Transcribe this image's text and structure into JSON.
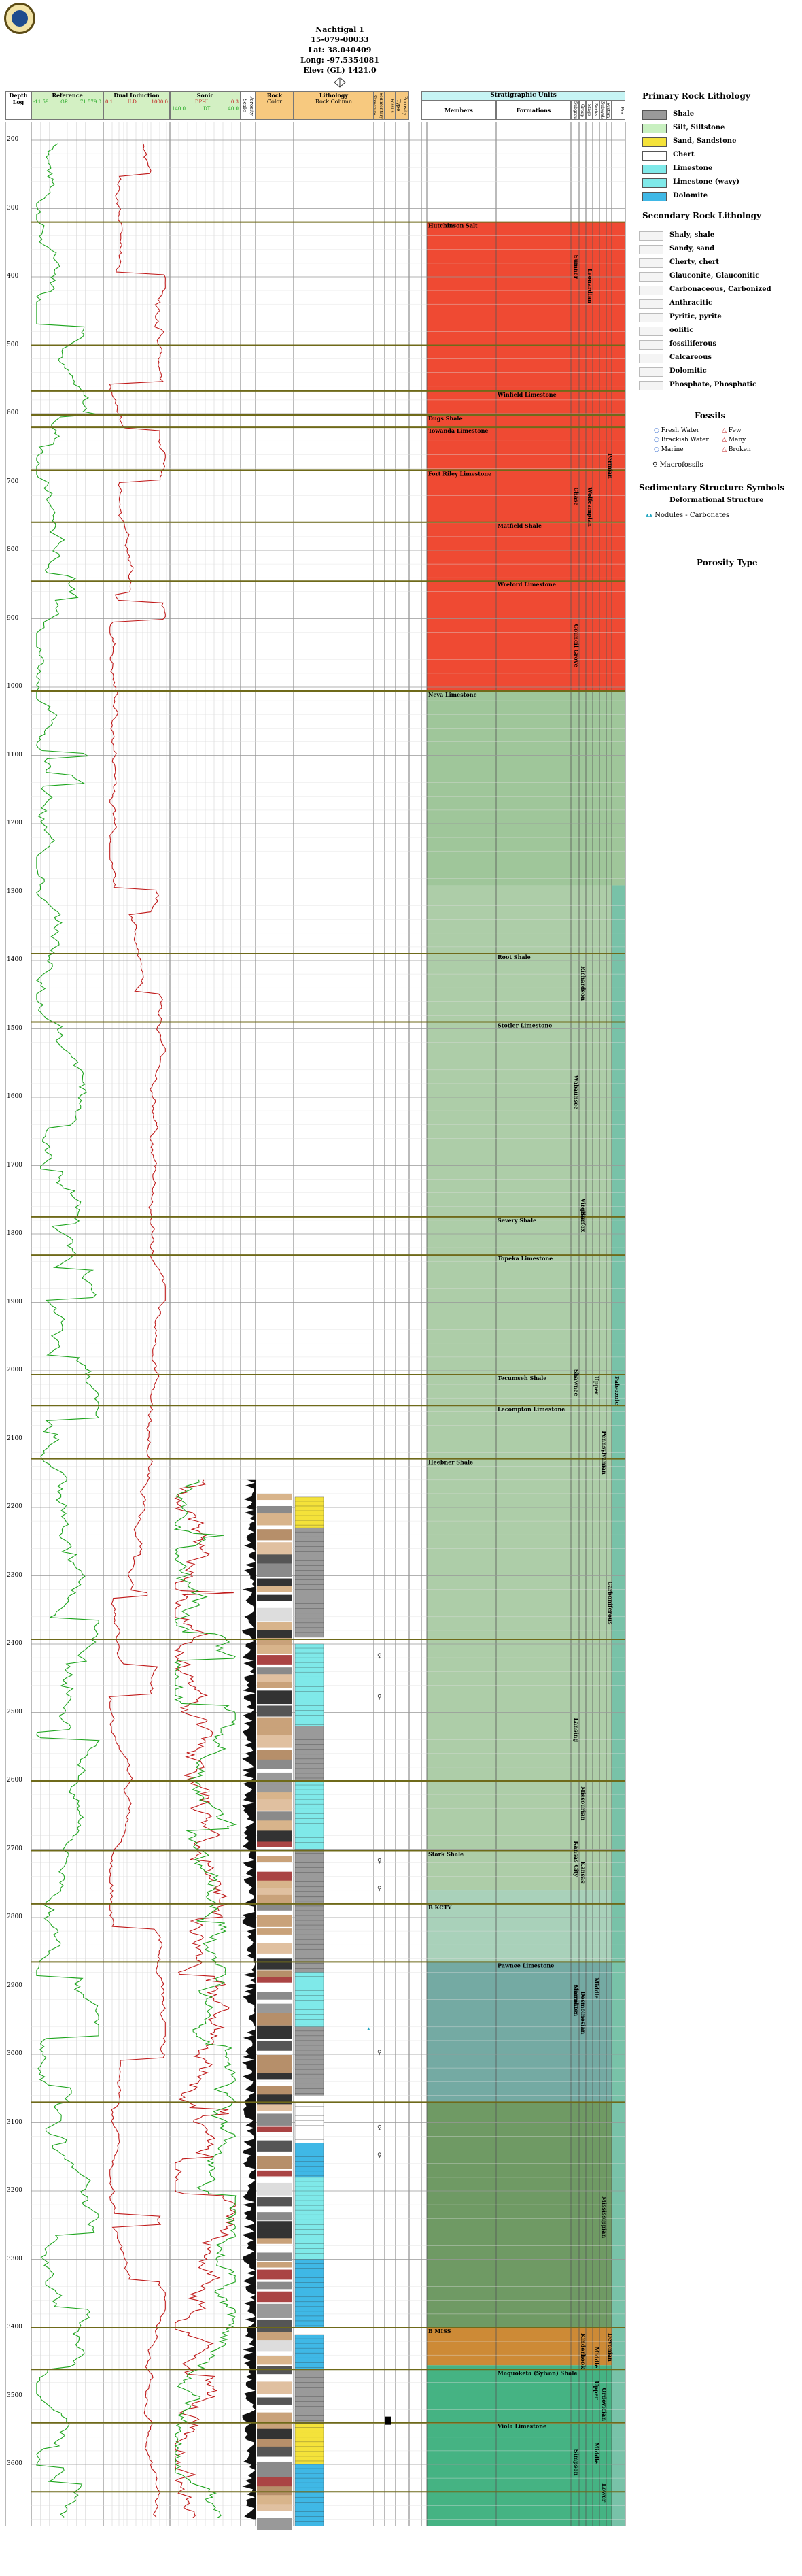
{
  "well": {
    "name": "Nachtigal 1",
    "api": "15-079-00033",
    "lat": "Lat: 38.040409",
    "long": "Long: -97.5354081",
    "elev": "Elev: (GL) 1421.0"
  },
  "columns": {
    "depth_title": "Depth",
    "depth_sub": "Log",
    "reference": "Reference",
    "reference_scale_left": "-11.59",
    "reference_scale_mid": "GR",
    "reference_scale_right": "71.579 0",
    "dual_induction": "Dual Induction",
    "dual_scale_left": "0.1",
    "dual_scale_mid": "ILD",
    "dual_scale_right": "1000 0",
    "sonic": "Sonic",
    "sonic_top": "DPHI",
    "sonic_top_right": "0.3",
    "sonic_bottom_left": "140 0",
    "sonic_bottom_mid": "DT",
    "sonic_bottom_right": "40 0",
    "porosity_scale": "Porosity Scale",
    "rock_color": "Rock",
    "rock_color_sub": "Color",
    "lithology": "Lithology",
    "lithology_sub": "Rock Column",
    "sedimentary": "Sedimentary Structure",
    "fossils": "Fossils",
    "porosity_type": "Porosity Type",
    "stratigraphic_units": "Stratigraphic Units",
    "members": "Members",
    "formations": "Formations",
    "sub_cols": [
      "Subgroup",
      "Group",
      "Stage",
      "Series",
      "Subsystem",
      "System",
      "Era"
    ]
  },
  "depth_ticks": [
    "200",
    "300",
    "400",
    "500",
    "600",
    "700",
    "800",
    "900",
    "1000",
    "1100",
    "1200",
    "1300",
    "1400",
    "1500",
    "1600",
    "1700",
    "1800",
    "1900",
    "2000",
    "2100",
    "2200",
    "2300",
    "2400",
    "2500",
    "2600",
    "2700",
    "2800",
    "2900",
    "3000",
    "3100",
    "3200",
    "3300",
    "3400",
    "3500",
    "3600"
  ],
  "members": [
    {
      "depth": 320,
      "label": "Hutchinson Salt"
    },
    {
      "depth": 602,
      "label": "Dugs Shale"
    },
    {
      "depth": 620,
      "label": "Towanda Limestone"
    },
    {
      "depth": 683,
      "label": "Fort Riley Limestone"
    },
    {
      "depth": 1006,
      "label": "Neva Limestone"
    },
    {
      "depth": 2129,
      "label": "Heebner Shale"
    },
    {
      "depth": 2702,
      "label": "Stark Shale"
    },
    {
      "depth": 2780,
      "label": "B KCTY"
    },
    {
      "depth": 3400,
      "label": "B MISS"
    }
  ],
  "formations": [
    {
      "depth": 567,
      "label": "Winfield Limestone"
    },
    {
      "depth": 759,
      "label": "Matfield Shale"
    },
    {
      "depth": 845,
      "label": "Wreford Limestone"
    },
    {
      "depth": 1390,
      "label": "Root Shale"
    },
    {
      "depth": 1490,
      "label": "Stotler Limestone"
    },
    {
      "depth": 1775,
      "label": "Severy Shale"
    },
    {
      "depth": 1831,
      "label": "Topeka Limestone"
    },
    {
      "depth": 2006,
      "label": "Tecumseh Shale"
    },
    {
      "depth": 2051,
      "label": "Lecompton Limestone"
    },
    {
      "depth": 2865,
      "label": "Pawnee Limestone"
    },
    {
      "depth": 3461,
      "label": "Maquoketa (Sylvan) Shale"
    },
    {
      "depth": 3539,
      "label": "Viola Limestone"
    }
  ],
  "group_labels": [
    {
      "col": 0,
      "depth": 360,
      "label": "Sumner"
    },
    {
      "col": 0,
      "depth": 700,
      "label": "Chase"
    },
    {
      "col": 0,
      "depth": 900,
      "label": "Council Grove"
    },
    {
      "col": 0,
      "depth": 1560,
      "label": "Wabaunsee"
    },
    {
      "col": 0,
      "depth": 1990,
      "label": "Shawnee"
    },
    {
      "col": 0,
      "depth": 2500,
      "label": "Lansing"
    },
    {
      "col": 0,
      "depth": 2680,
      "label": "Kansas City"
    },
    {
      "col": 0,
      "depth": 2890,
      "label": "Marmaton"
    },
    {
      "col": 0,
      "depth": 2890,
      "label": "Cherokee"
    },
    {
      "col": 0,
      "depth": 3570,
      "label": "Simpson"
    },
    {
      "col": 1,
      "depth": 1760,
      "label": "Sacfox"
    },
    {
      "col": 1,
      "depth": 1740,
      "label": "Virgilian"
    },
    {
      "col": 1,
      "depth": 2710,
      "label": "Kansas"
    },
    {
      "col": 1,
      "depth": 2600,
      "label": "Missourian"
    },
    {
      "col": 1,
      "depth": 2900,
      "label": "Desmoinesian"
    },
    {
      "col": 1,
      "depth": 3400,
      "label": "Kinderhook"
    },
    {
      "col": 1,
      "depth": 1400,
      "label": "Richardson"
    },
    {
      "col": 2,
      "depth": 700,
      "label": "Wolfcampian"
    },
    {
      "col": 3,
      "depth": 2000,
      "label": "Upper"
    },
    {
      "col": 3,
      "depth": 2880,
      "label": "Middle"
    },
    {
      "col": 3,
      "depth": 3470,
      "label": "Upper"
    },
    {
      "col": 3,
      "depth": 3560,
      "label": "Middle"
    },
    {
      "col": 3,
      "depth": 3420,
      "label": "Middle"
    },
    {
      "col": 4,
      "depth": 2080,
      "label": "Pennsylvanian"
    },
    {
      "col": 4,
      "depth": 3200,
      "label": "Mississippian"
    },
    {
      "col": 4,
      "depth": 3480,
      "label": "Ordovician"
    },
    {
      "col": 4,
      "depth": 3620,
      "label": "Lower"
    },
    {
      "col": 5,
      "depth": 650,
      "label": "Permian"
    },
    {
      "col": 5,
      "depth": 2300,
      "label": "Carboniferous"
    },
    {
      "col": 5,
      "depth": 3400,
      "label": "Devonian"
    },
    {
      "col": 6,
      "depth": 2000,
      "label": "Paleozoic"
    },
    {
      "col": 2,
      "depth": 380,
      "label": "Leonardian"
    }
  ],
  "legend": {
    "primary_title": "Primary Rock Lithology",
    "primary": [
      {
        "label": "Shale",
        "color": "#9a9a9a"
      },
      {
        "label": "Silt, Siltstone",
        "color": "#c8f0c0"
      },
      {
        "label": "Sand, Sandstone",
        "color": "#f4e23a"
      },
      {
        "label": "Chert",
        "color": "#ffffff"
      },
      {
        "label": "Limestone",
        "color": "#7fe9e9"
      },
      {
        "label": "Limestone (wavy)",
        "color": "#7fe9e9"
      },
      {
        "label": "Dolomite",
        "color": "#3fb8e6"
      }
    ],
    "secondary_title": "Secondary Rock Lithology",
    "secondary": [
      "Shaly, shale",
      "Sandy, sand",
      "Cherty, chert",
      "Glauconite, Glauconitic",
      "Carbonaceous, Carbonized",
      "Anthracitic",
      "Pyritic, pyrite",
      "oolitic",
      "fossiliferous",
      "Calcareous",
      "Dolomitic",
      "Phosphate, Phosphatic"
    ],
    "fossils_title": "Fossils",
    "fossil_items": [
      "Fresh Water",
      "Brackish Water",
      "Marine",
      "Few",
      "Many",
      "Broken"
    ],
    "macrofossils": "Macrofossils",
    "sed_title": "Sedimentary Structure Symbols",
    "sed_sub": "Deformational Structure",
    "sed_item": "Nodules - Carbonates",
    "porosity_title": "Porosity Type"
  },
  "colors": {
    "permian": "#ef4a33",
    "upper_penn": "#9fc69a",
    "middle_penn_a": "#a9d1ba",
    "middle_penn_b": "#74aaa3",
    "mississippian": "#6f9a64",
    "devonian": "#cd8a36",
    "ordovician": "#45b383",
    "marker": "#6f6a1a",
    "gr": "#1ea51e",
    "res": "#c01a1a",
    "era": "#78c2a8"
  }
}
